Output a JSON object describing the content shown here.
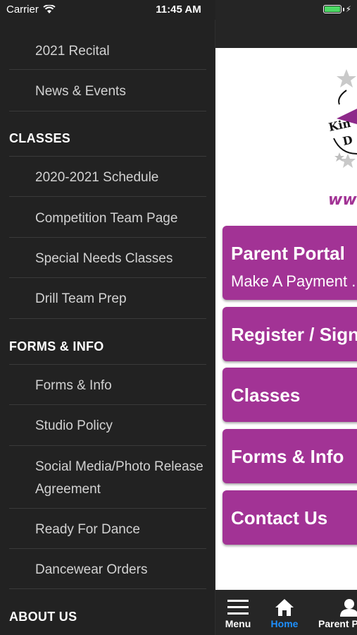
{
  "status_bar": {
    "carrier": "Carrier",
    "time": "11:45 AM"
  },
  "side_menu": {
    "rows": [
      {
        "type": "item",
        "label": "2021 Recital"
      },
      {
        "type": "item",
        "label": "News & Events"
      },
      {
        "type": "section",
        "label": "CLASSES"
      },
      {
        "type": "item",
        "label": "2020-2021 Schedule"
      },
      {
        "type": "item",
        "label": "Competition Team Page"
      },
      {
        "type": "item",
        "label": "Special Needs Classes"
      },
      {
        "type": "item",
        "label": "Drill Team Prep"
      },
      {
        "type": "section",
        "label": "FORMS & INFO"
      },
      {
        "type": "item",
        "label": "Forms & Info"
      },
      {
        "type": "item",
        "label": "Studio Policy"
      },
      {
        "type": "item",
        "label": "Social Media/Photo Release Agreement"
      },
      {
        "type": "item",
        "label": "Ready For Dance"
      },
      {
        "type": "item",
        "label": "Dancewear Orders"
      },
      {
        "type": "section",
        "label": "ABOUT US"
      }
    ]
  },
  "main": {
    "logo": {
      "text_line1": "Kin",
      "text_line2": "D",
      "url_fragment": "www."
    },
    "tiles": [
      {
        "title": "Parent Portal",
        "subtitle": "Make A Payment ..."
      },
      {
        "title": "Register / Sign"
      },
      {
        "title": "Classes"
      },
      {
        "title": "Forms & Info"
      },
      {
        "title": "Contact Us"
      }
    ]
  },
  "tab_bar": {
    "menu_label": "Menu",
    "home_label": "Home",
    "parent_label": "Parent P",
    "active_color": "#1e90ff"
  },
  "colors": {
    "menu_bg": "#222222",
    "tile_bg": "#a23395",
    "battery": "#4cd964"
  }
}
